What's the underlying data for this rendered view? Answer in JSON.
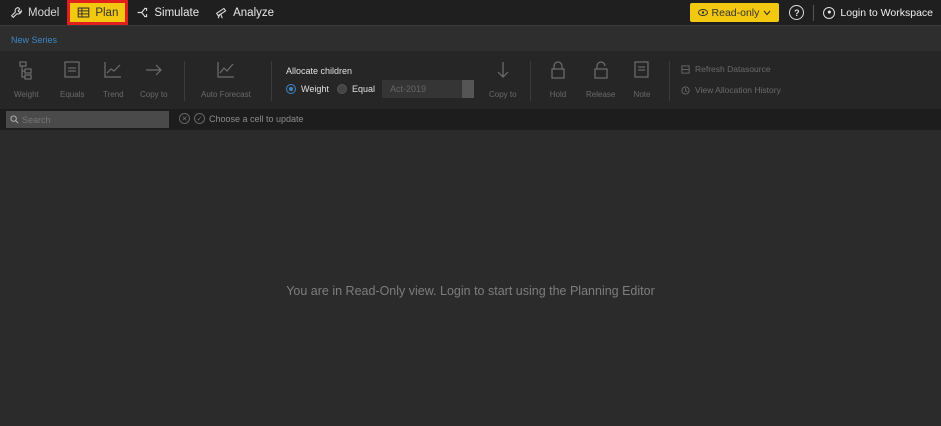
{
  "nav": {
    "model": "Model",
    "plan": "Plan",
    "simulate": "Simulate",
    "analyze": "Analyze"
  },
  "top_right": {
    "readonly": "Read-only",
    "help": "?",
    "login": "Login to Workspace"
  },
  "series": {
    "label": "New Series"
  },
  "ribbon": {
    "weight": "Weight",
    "equals": "Equals",
    "trend": "Trend",
    "copy_to": "Copy to",
    "auto_forecast": "Auto Forecast",
    "allocate_title": "Allocate children",
    "radio_weight": "Weight",
    "radio_equal": "Equal",
    "act_value": "Act-2019",
    "copy_to_2": "Copy to",
    "hold": "Hold",
    "release": "Release",
    "note": "Note",
    "refresh": "Refresh Datasource",
    "history": "View Allocation History"
  },
  "search": {
    "placeholder": "Search",
    "cell_message": "Choose a cell to update"
  },
  "main": {
    "readonly_message": "You are in Read-Only view. Login to start using the Planning Editor"
  },
  "colors": {
    "accent_yellow": "#f2c811",
    "highlight_red": "#e0201b",
    "link_blue": "#3d86c6"
  }
}
